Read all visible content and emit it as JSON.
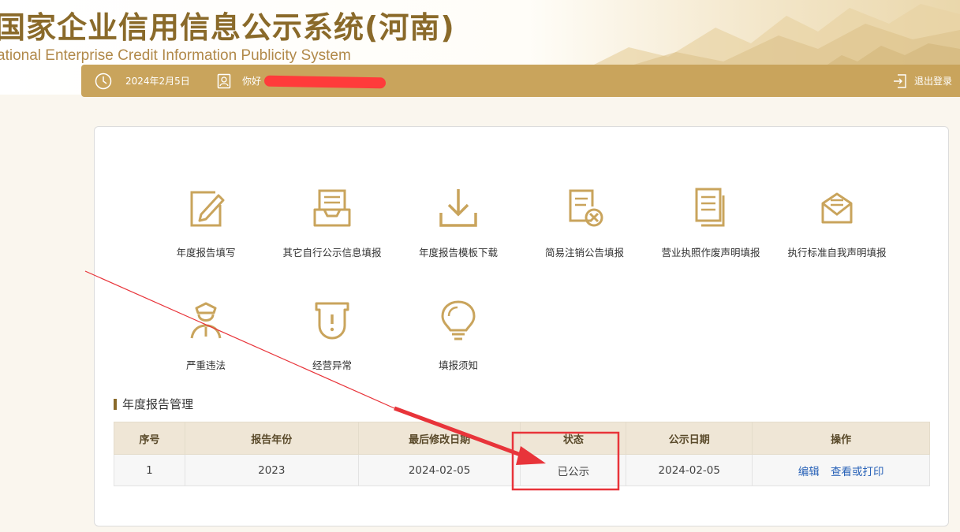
{
  "header": {
    "title_cn": "国家企业信用信息公示系统(河南)",
    "title_en": "ational Enterprise Credit Information Publicity System"
  },
  "topbar": {
    "date": "2024年2月5日",
    "greeting": "你好",
    "logout": "退出登录"
  },
  "tiles": [
    {
      "label": "年度报告填写",
      "icon": "edit-report-icon"
    },
    {
      "label": "其它自行公示信息填报",
      "icon": "inbox-tray-icon"
    },
    {
      "label": "年度报告模板下载",
      "icon": "download-icon"
    },
    {
      "label": "简易注销公告填报",
      "icon": "cancel-document-icon"
    },
    {
      "label": "营业执照作废声明填报",
      "icon": "document-list-icon"
    },
    {
      "label": "执行标准自我声明填报",
      "icon": "envelope-icon"
    },
    {
      "label": "严重违法",
      "icon": "police-officer-icon"
    },
    {
      "label": "经营异常",
      "icon": "warning-shield-icon"
    },
    {
      "label": "填报须知",
      "icon": "lightbulb-icon"
    }
  ],
  "section": {
    "title": "年度报告管理"
  },
  "table": {
    "headers": [
      "序号",
      "报告年份",
      "最后修改日期",
      "状态",
      "公示日期",
      "操作"
    ],
    "rows": [
      {
        "index": "1",
        "year": "2023",
        "modified": "2024-02-05",
        "status": "已公示",
        "publish_date": "2024-02-05",
        "actions": [
          "编辑",
          "查看或打印"
        ]
      }
    ]
  },
  "colors": {
    "accent": "#c9a45c",
    "icon": "#c9a45c",
    "link": "#2a63b8",
    "annotation": "#e8343a"
  }
}
